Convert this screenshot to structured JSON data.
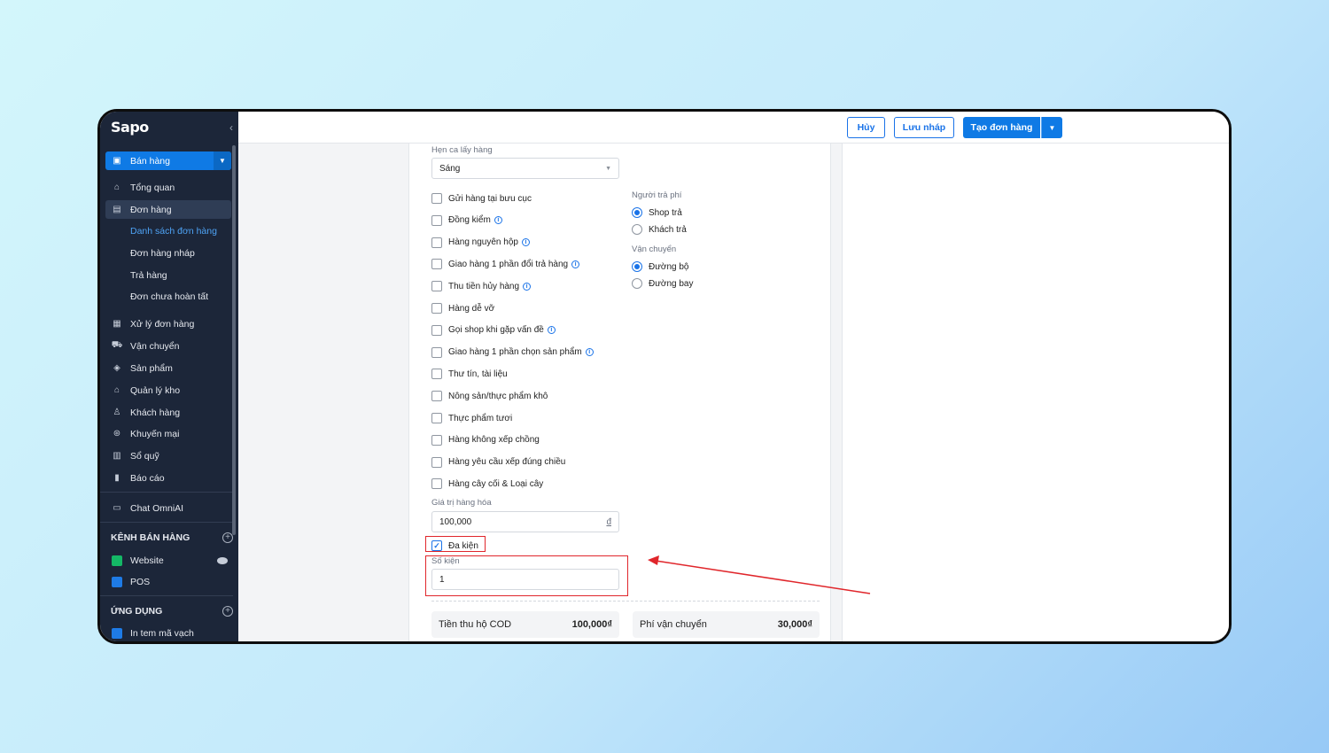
{
  "sidebar": {
    "logo": "Sapo",
    "collapse_icon": "chevron-left-icon",
    "primary": "Bán hàng",
    "items_top": [
      {
        "label": "Tổng quan",
        "icon": "home-icon"
      },
      {
        "label": "Đơn hàng",
        "icon": "order-icon"
      }
    ],
    "sub_items": [
      "Danh sách đơn hàng",
      "Đơn hàng nháp",
      "Trả hàng",
      "Đơn chưa hoàn tất"
    ],
    "items_main": [
      {
        "label": "Xử lý đơn hàng",
        "icon": "process-icon"
      },
      {
        "label": "Vận chuyển",
        "icon": "truck-icon"
      },
      {
        "label": "Sản phẩm",
        "icon": "box-icon"
      },
      {
        "label": "Quản lý kho",
        "icon": "warehouse-icon"
      },
      {
        "label": "Khách hàng",
        "icon": "user-icon"
      },
      {
        "label": "Khuyến mại",
        "icon": "discount-icon"
      },
      {
        "label": "Sổ quỹ",
        "icon": "ledger-icon"
      },
      {
        "label": "Báo cáo",
        "icon": "chart-icon"
      }
    ],
    "chat": "Chat OmniAI",
    "sales_channels_title": "KÊNH BÁN HÀNG",
    "channels": [
      "Website",
      "POS"
    ],
    "apps_title": "ỨNG DỤNG",
    "apps": [
      "In tem mã vạch"
    ]
  },
  "topbar": {
    "cancel": "Hủy",
    "save_draft": "Lưu nháp",
    "create_order": "Tạo đơn hàng"
  },
  "form": {
    "pickup_label": "Hẹn ca lấy hàng",
    "pickup_value": "Sáng",
    "options": [
      {
        "label": "Gửi hàng tại bưu cục",
        "info": false
      },
      {
        "label": "Đồng kiểm",
        "info": true
      },
      {
        "label": "Hàng nguyên hộp",
        "info": true
      },
      {
        "label": "Giao hàng 1 phần đổi trả hàng",
        "info": true
      },
      {
        "label": "Thu tiền hủy hàng",
        "info": true
      },
      {
        "label": "Hàng dễ vỡ",
        "info": false
      },
      {
        "label": "Gọi shop khi gặp vấn đề",
        "info": true
      },
      {
        "label": "Giao hàng 1 phần chọn sản phẩm",
        "info": true
      },
      {
        "label": "Thư tín, tài liệu",
        "info": false
      },
      {
        "label": "Nông sản/thực phẩm khô",
        "info": false
      },
      {
        "label": "Thực phẩm tươi",
        "info": false
      },
      {
        "label": "Hàng không xếp chồng",
        "info": false
      },
      {
        "label": "Hàng yêu cầu xếp đúng chiều",
        "info": false
      },
      {
        "label": "Hàng cây cối & Loại cây",
        "info": false
      }
    ],
    "payer_label": "Người trả phí",
    "payer_options": [
      "Shop trả",
      "Khách trả"
    ],
    "shipping_label": "Vận chuyển",
    "shipping_options": [
      "Đường bộ",
      "Đường bay"
    ],
    "goods_value_label": "Giá trị hàng hóa",
    "goods_value": "100,000",
    "currency": "đ",
    "multi_package": "Đa kiện",
    "package_count_label": "Số kiện",
    "package_count": "1",
    "cod_label": "Tiền thu hộ COD",
    "cod_value": "100,000₫",
    "shipping_fee_label": "Phí vận chuyển",
    "shipping_fee_value": "30,000₫"
  },
  "colors": {
    "accent": "#0f7ae5",
    "sidebar": "#1c2639",
    "highlight": "#e0262b"
  }
}
